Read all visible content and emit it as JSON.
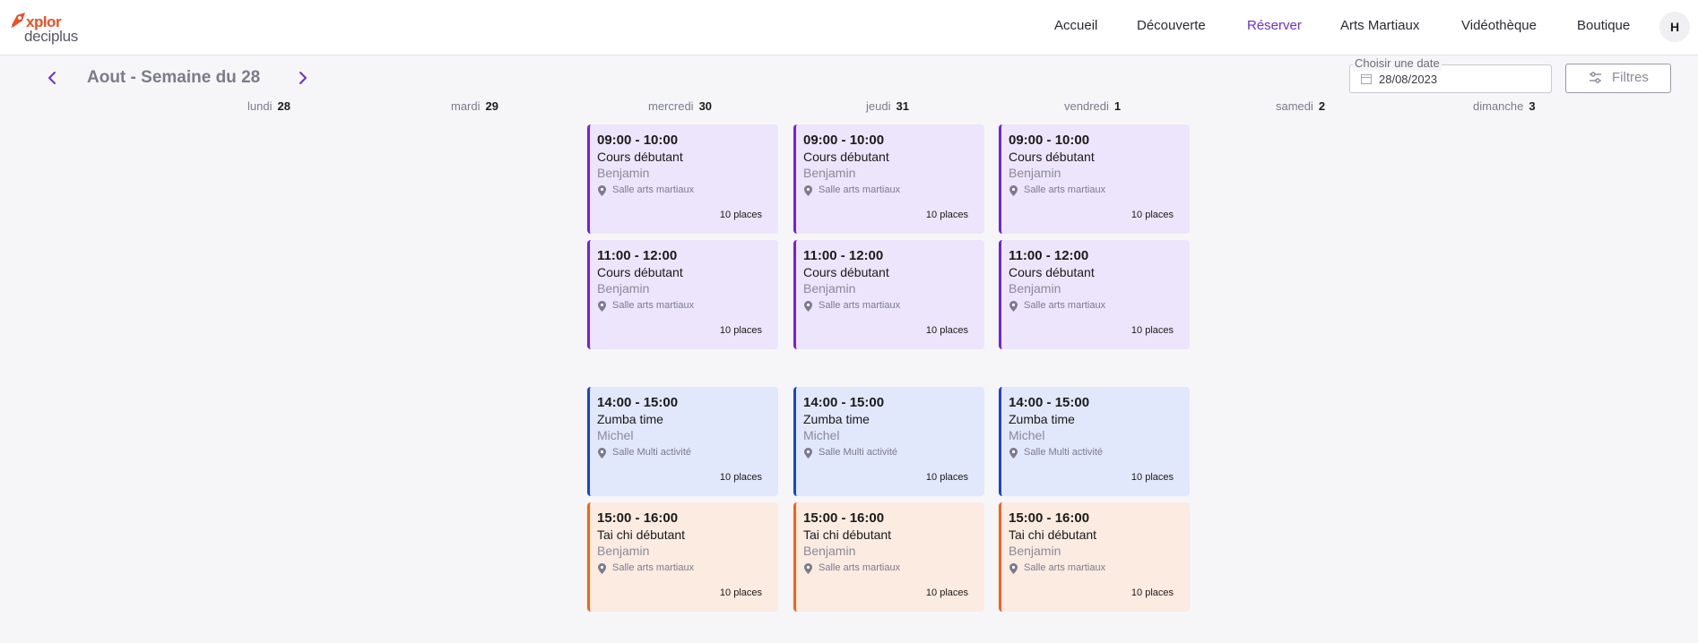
{
  "brand": {
    "logo_top": "xplor",
    "logo_bottom": "deciplus",
    "accent_color": "#f04e23"
  },
  "nav": {
    "items": [
      {
        "label": "Accueil"
      },
      {
        "label": "Découverte"
      },
      {
        "label": "Réserver",
        "active": true
      },
      {
        "label": "Arts Martiaux"
      },
      {
        "label": "Vidéothèque"
      },
      {
        "label": "Boutique"
      }
    ],
    "active_color": "#6f2dd8",
    "avatar_initial": "H"
  },
  "week": {
    "title": "Aout - Semaine du 28",
    "prev_icon": "chevron-left-icon",
    "next_icon": "chevron-right-icon"
  },
  "date_picker": {
    "label": "Choisir une date",
    "value": "28/08/2023",
    "icon": "calendar-icon"
  },
  "filters": {
    "label": "Filtres",
    "icon": "sliders-icon"
  },
  "days": [
    {
      "name": "lundi",
      "num": "28"
    },
    {
      "name": "mardi",
      "num": "29"
    },
    {
      "name": "mercredi",
      "num": "30"
    },
    {
      "name": "jeudi",
      "num": "31"
    },
    {
      "name": "vendredi",
      "num": "1"
    },
    {
      "name": "samedi",
      "num": "2"
    },
    {
      "name": "dimanche",
      "num": "3"
    }
  ],
  "event_colors": {
    "purple": {
      "bg": "#ede5fb",
      "bar": "#6f25d6"
    },
    "blue": {
      "bg": "#e1e8fb",
      "bar": "#1d43c9"
    },
    "orange": {
      "bg": "#fcebe1",
      "bar": "#ee6420"
    }
  },
  "events": {
    "mercredi": [
      {
        "time": "09:00 - 10:00",
        "title": "Cours débutant",
        "coach": "Benjamin",
        "room": "Salle arts martiaux",
        "places": "10 places",
        "color": "purple"
      },
      {
        "time": "11:00 - 12:00",
        "title": "Cours débutant",
        "coach": "Benjamin",
        "room": "Salle arts martiaux",
        "places": "10 places",
        "color": "purple"
      },
      {
        "time": "14:00 - 15:00",
        "title": "Zumba time",
        "coach": "Michel",
        "room": "Salle Multi activité",
        "places": "10 places",
        "color": "blue"
      },
      {
        "time": "15:00 - 16:00",
        "title": "Tai chi débutant",
        "coach": "Benjamin",
        "room": "Salle arts martiaux",
        "places": "10 places",
        "color": "orange"
      }
    ],
    "jeudi": [
      {
        "time": "09:00 - 10:00",
        "title": "Cours débutant",
        "coach": "Benjamin",
        "room": "Salle arts martiaux",
        "places": "10 places",
        "color": "purple"
      },
      {
        "time": "11:00 - 12:00",
        "title": "Cours débutant",
        "coach": "Benjamin",
        "room": "Salle arts martiaux",
        "places": "10 places",
        "color": "purple"
      },
      {
        "time": "14:00 - 15:00",
        "title": "Zumba time",
        "coach": "Michel",
        "room": "Salle Multi activité",
        "places": "10 places",
        "color": "blue"
      },
      {
        "time": "15:00 - 16:00",
        "title": "Tai chi débutant",
        "coach": "Benjamin",
        "room": "Salle arts martiaux",
        "places": "10 places",
        "color": "orange"
      }
    ],
    "vendredi": [
      {
        "time": "09:00 - 10:00",
        "title": "Cours débutant",
        "coach": "Benjamin",
        "room": "Salle arts martiaux",
        "places": "10 places",
        "color": "purple"
      },
      {
        "time": "11:00 - 12:00",
        "title": "Cours débutant",
        "coach": "Benjamin",
        "room": "Salle arts martiaux",
        "places": "10 places",
        "color": "purple"
      },
      {
        "time": "14:00 - 15:00",
        "title": "Zumba time",
        "coach": "Michel",
        "room": "Salle Multi activité",
        "places": "10 places",
        "color": "blue"
      },
      {
        "time": "15:00 - 16:00",
        "title": "Tai chi débutant",
        "coach": "Benjamin",
        "room": "Salle arts martiaux",
        "places": "10 places",
        "color": "orange"
      }
    ]
  }
}
